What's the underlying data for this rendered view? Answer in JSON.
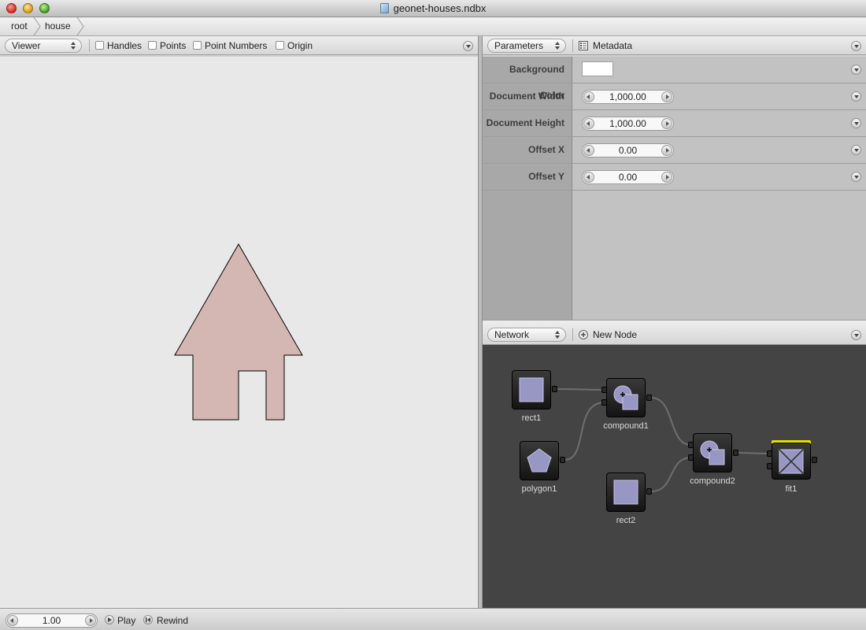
{
  "window": {
    "title": "geonet-houses.ndbx"
  },
  "breadcrumb": [
    {
      "label": "root"
    },
    {
      "label": "house"
    }
  ],
  "viewer": {
    "mode": "Viewer",
    "options": [
      {
        "label": "Handles",
        "checked": false
      },
      {
        "label": "Points",
        "checked": false
      },
      {
        "label": "Point Numbers",
        "checked": false
      },
      {
        "label": "Origin",
        "checked": false
      }
    ],
    "house_fill": "#d4b6b3"
  },
  "parameters": {
    "mode": "Parameters",
    "metadata_label": "Metadata",
    "rows": [
      {
        "label": "Background Color",
        "type": "color",
        "value": "#ffffff"
      },
      {
        "label": "Document Width",
        "type": "number",
        "value": "1,000.00"
      },
      {
        "label": "Document Height",
        "type": "number",
        "value": "1,000.00"
      },
      {
        "label": "Offset X",
        "type": "number",
        "value": "0.00"
      },
      {
        "label": "Offset Y",
        "type": "number",
        "value": "0.00"
      }
    ]
  },
  "network": {
    "mode": "Network",
    "new_node_label": "New Node",
    "nodes": [
      {
        "label": "rect1",
        "icon": "rect-icon"
      },
      {
        "label": "compound1",
        "icon": "compound-icon"
      },
      {
        "label": "polygon1",
        "icon": "polygon-icon"
      },
      {
        "label": "compound2",
        "icon": "compound-icon"
      },
      {
        "label": "rect2",
        "icon": "rect-icon"
      },
      {
        "label": "fit1",
        "icon": "fit-icon",
        "rendered": true
      }
    ]
  },
  "playback": {
    "frame": "1.00",
    "play_label": "Play",
    "rewind_label": "Rewind"
  },
  "colors": {
    "node_icon": "#9896c2",
    "rendered_marker": "#e8e000",
    "network_bg": "#444444"
  }
}
